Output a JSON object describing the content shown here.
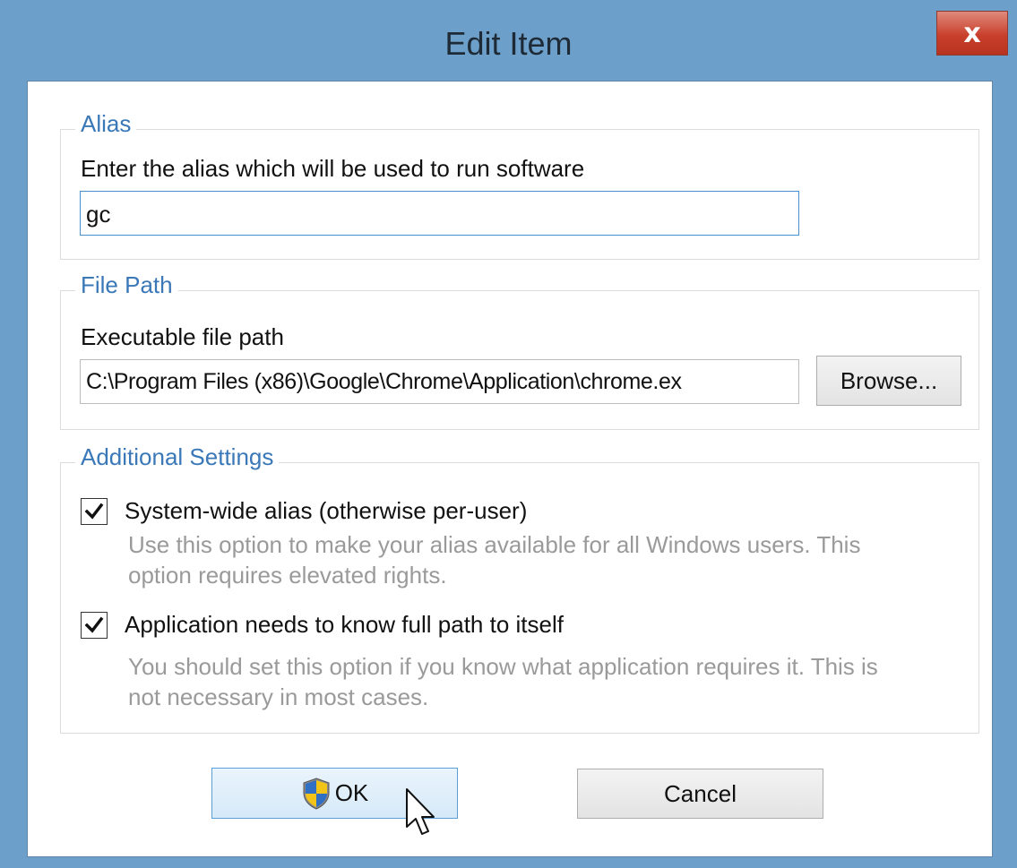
{
  "window": {
    "title": "Edit Item",
    "close_label": "x"
  },
  "alias_group": {
    "legend": "Alias",
    "prompt": "Enter the alias which will be used to run software",
    "value": "gc"
  },
  "filepath_group": {
    "legend": "File Path",
    "prompt": "Executable file path",
    "value": "C:\\Program Files (x86)\\Google\\Chrome\\Application\\chrome.ex",
    "browse_label": "Browse..."
  },
  "settings_group": {
    "legend": "Additional Settings",
    "options": [
      {
        "label": "System-wide alias (otherwise per-user)",
        "checked": true,
        "hint_line1": "Use this option to make your alias available for all Windows users. This",
        "hint_line2": "option requires elevated rights."
      },
      {
        "label": "Application needs to know full path to itself",
        "checked": true,
        "hint_line1": "You should set this option if you know what application requires it. This is",
        "hint_line2": "not necessary in most cases."
      }
    ]
  },
  "buttons": {
    "ok_label": "OK",
    "cancel_label": "Cancel"
  },
  "icons": {
    "close": "close-icon",
    "shield": "uac-shield-icon",
    "check": "checkmark-icon",
    "cursor": "mouse-pointer-icon"
  }
}
